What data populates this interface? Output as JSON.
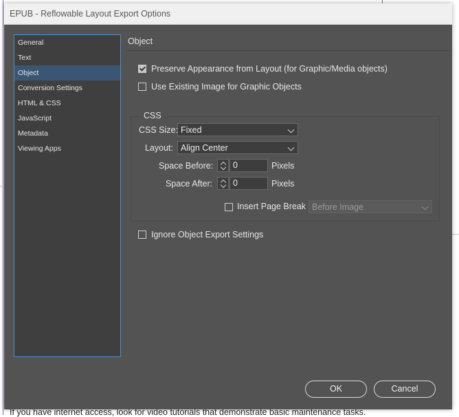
{
  "window": {
    "title": "EPUB - Reflowable Layout Export Options"
  },
  "sidebar": {
    "items": [
      {
        "label": "General"
      },
      {
        "label": "Text"
      },
      {
        "label": "Object"
      },
      {
        "label": "Conversion Settings"
      },
      {
        "label": "HTML & CSS"
      },
      {
        "label": "JavaScript"
      },
      {
        "label": "Metadata"
      },
      {
        "label": "Viewing Apps"
      }
    ],
    "active_index": 2
  },
  "object": {
    "section_title": "Object",
    "preserve_appearance": {
      "label": "Preserve Appearance from Layout (for Graphic/Media objects)",
      "checked": true
    },
    "use_existing_image": {
      "label": "Use Existing Image for Graphic Objects",
      "checked": false
    },
    "css": {
      "group_title": "CSS",
      "css_size_label": "CSS Size:",
      "css_size_value": "Fixed",
      "layout_label": "Layout:",
      "layout_value": "Align Center",
      "space_before_label": "Space Before:",
      "space_before_value": "0",
      "space_before_unit": "Pixels",
      "space_after_label": "Space After:",
      "space_after_value": "0",
      "space_after_unit": "Pixels",
      "insert_page_break": {
        "label": "Insert Page Break",
        "checked": false
      },
      "page_break_value": "Before Image"
    },
    "ignore_object_export": {
      "label": "Ignore Object Export Settings",
      "checked": false
    }
  },
  "buttons": {
    "ok": "OK",
    "cancel": "Cancel"
  },
  "background": {
    "text": "If you have internet access, look for video tutorials that demonstrate basic maintenance tasks."
  }
}
